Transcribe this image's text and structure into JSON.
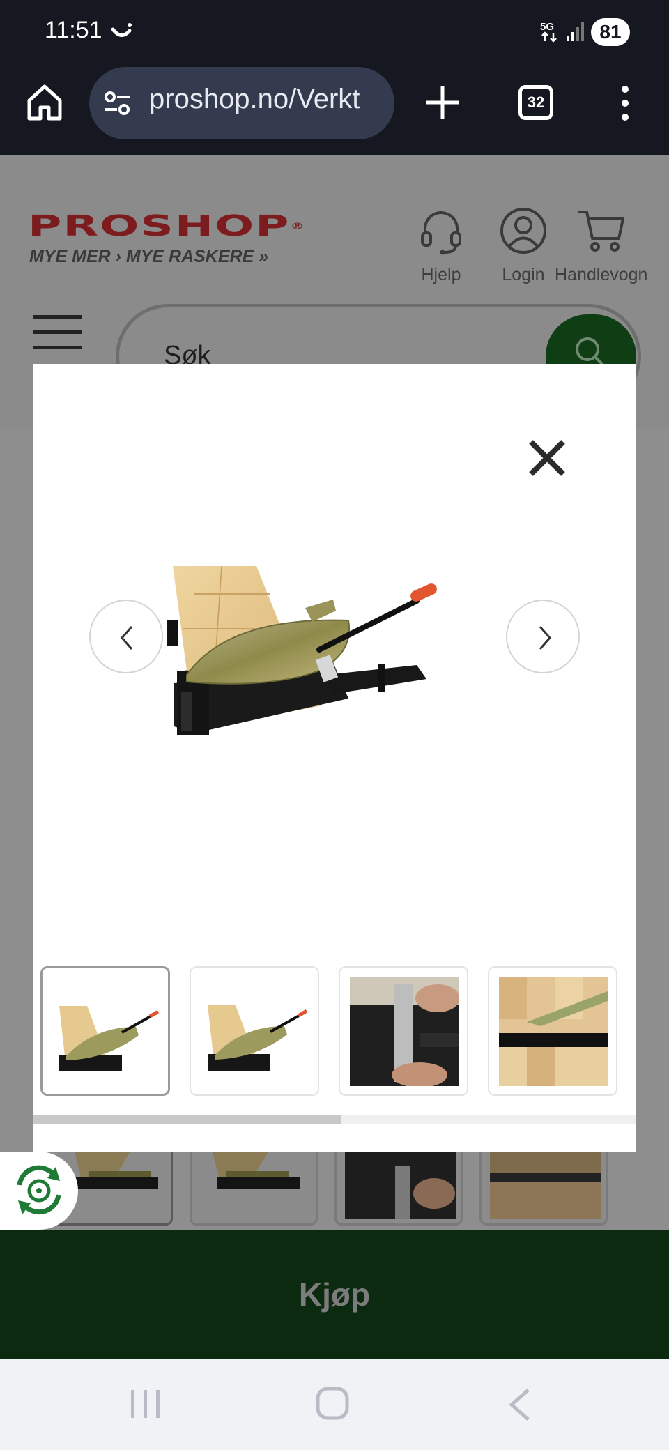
{
  "status_bar": {
    "time": "11:51",
    "network": "5G",
    "battery": "81"
  },
  "browser": {
    "url": "proshop.no/Verkt",
    "tab_count": "32"
  },
  "site_header": {
    "logo_text": "PROSHOP",
    "logo_reg": "®",
    "tagline": "MYE MER › MYE RASKERE »",
    "help_label": "Hjelp",
    "login_label": "Login",
    "cart_label": "Handlevogn",
    "search_placeholder": "Søk"
  },
  "gallery": {
    "thumbnails": [
      {
        "kind": "product-angle",
        "active": true
      },
      {
        "kind": "product-angle",
        "active": false
      },
      {
        "kind": "hands-detail",
        "active": false
      },
      {
        "kind": "blade-closeup",
        "active": false
      }
    ],
    "scroll_fraction": 0.51
  },
  "buy_button_label": "Kjøp",
  "colors": {
    "brand_red": "#d8242b",
    "buy_green": "#1e6b28",
    "status_bg": "#151821"
  },
  "icons": {
    "home": "home-icon",
    "close": "close-icon",
    "prev": "chevron-left-icon",
    "next": "chevron-right-icon",
    "help": "headset-icon",
    "login": "user-icon",
    "cart": "cart-icon",
    "search": "search-icon",
    "menu": "hamburger-icon",
    "eco": "recycle-icon"
  }
}
